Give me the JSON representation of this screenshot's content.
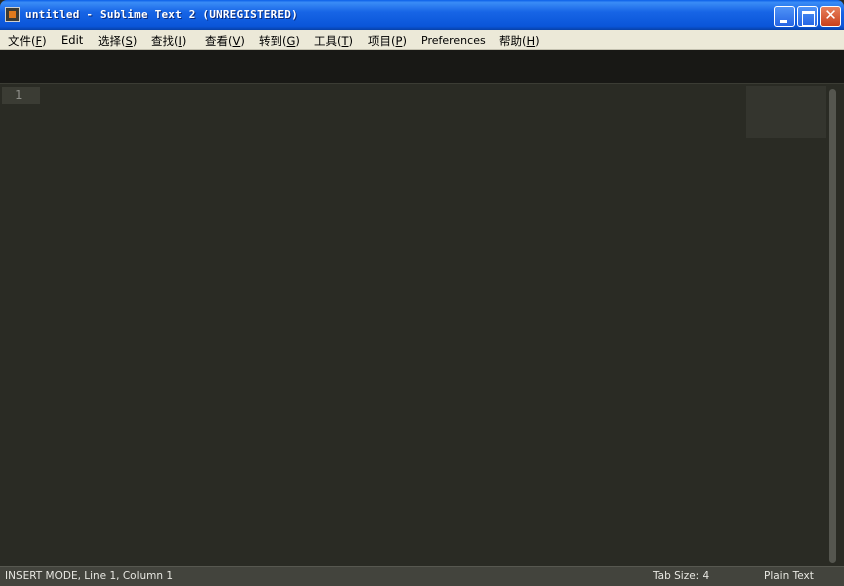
{
  "window": {
    "title": "untitled - Sublime Text 2 (UNREGISTERED)",
    "app_icon": "sublime-text-icon",
    "controls": {
      "minimize_icon": "minimize-icon",
      "maximize_icon": "maximize-icon",
      "close_glyph": "✕"
    }
  },
  "menubar": {
    "items": [
      {
        "label": "文件",
        "key": "F"
      },
      {
        "label": "Edit",
        "key": ""
      },
      {
        "label": "选择",
        "key": "S"
      },
      {
        "label": "查找",
        "key": "I"
      },
      {
        "label": "查看",
        "key": "V"
      },
      {
        "label": "转到",
        "key": "G"
      },
      {
        "label": "工具",
        "key": "T"
      },
      {
        "label": "项目",
        "key": "P"
      },
      {
        "label": "Preferences",
        "key": ""
      },
      {
        "label": "帮助",
        "key": "H"
      }
    ]
  },
  "editor": {
    "line_numbers": [
      "1"
    ],
    "content": ""
  },
  "statusbar": {
    "left": "INSERT MODE, Line 1, Column 1",
    "tab_size": "Tab Size: 4",
    "syntax": "Plain Text"
  },
  "colors": {
    "editor_bg": "#2a2b24",
    "tabstrip_bg": "#181815",
    "titlebar_blue": "#0a55d8",
    "menubar_bg": "#ece9d8",
    "statusbar_bg": "#43443d"
  }
}
